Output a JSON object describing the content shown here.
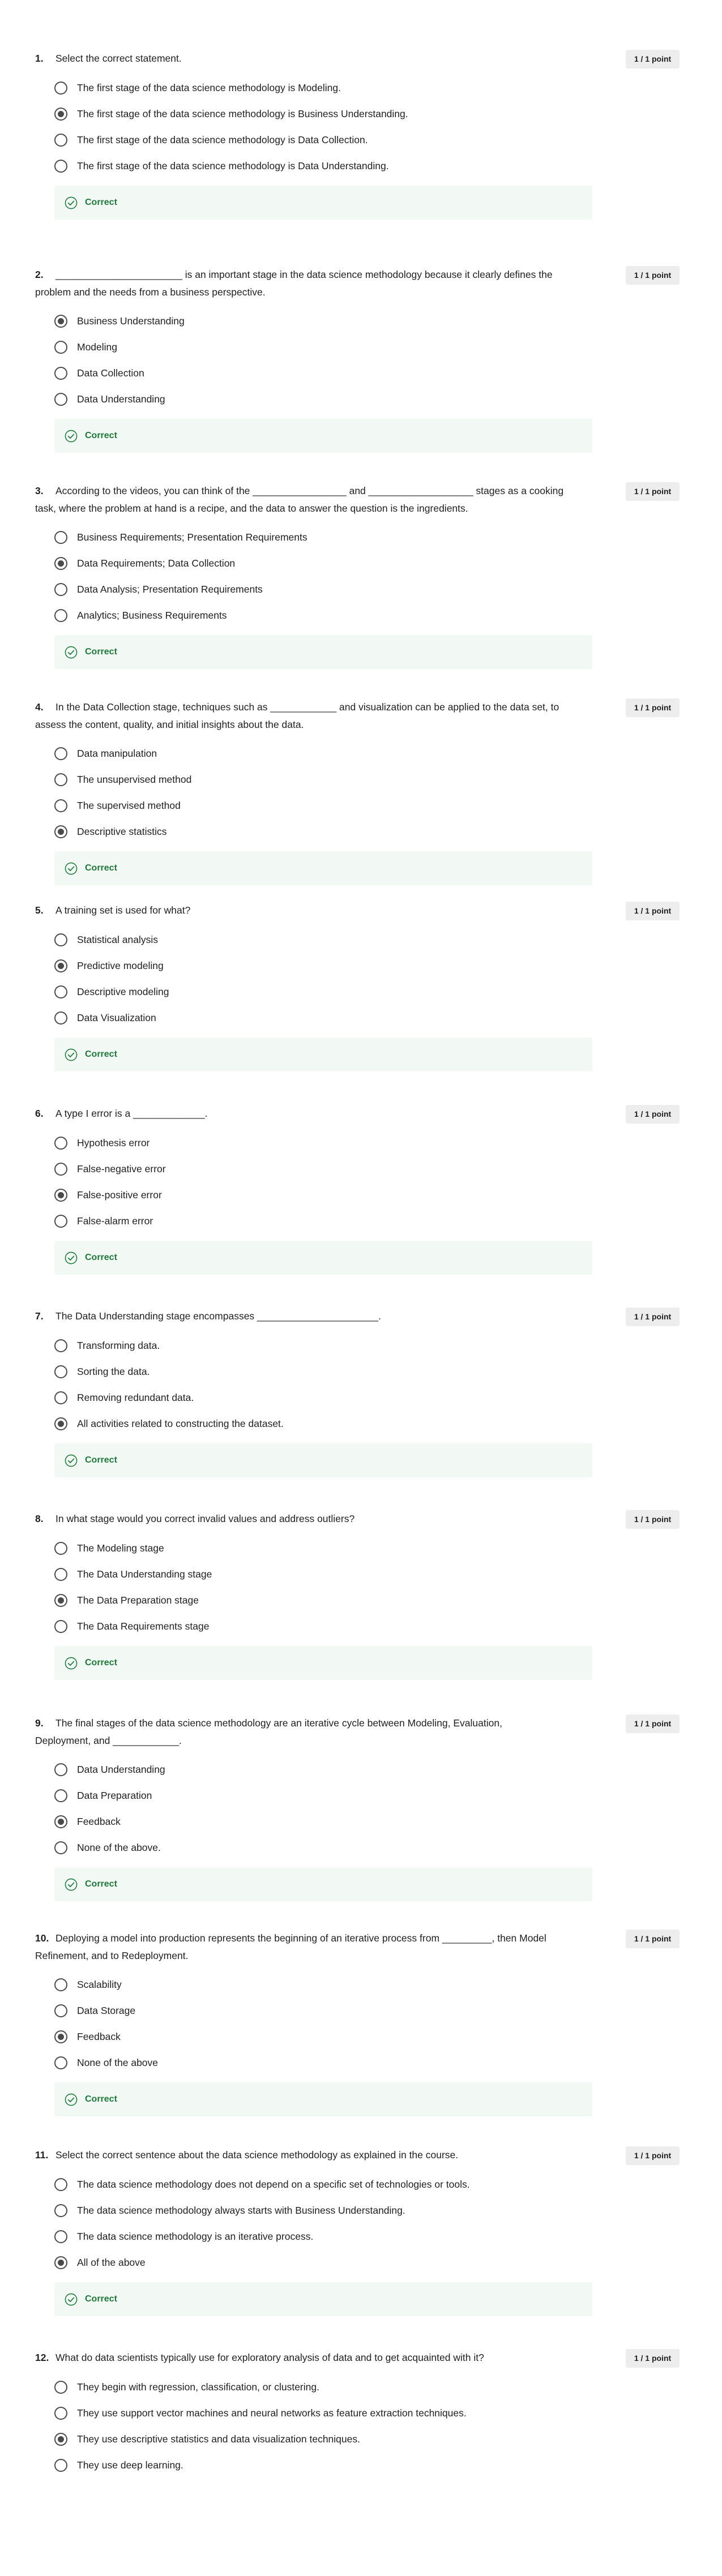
{
  "points_label": "1 / 1 point",
  "correct_label": "Correct",
  "questions": [
    {
      "number": "1.",
      "lines": [
        "Select the correct statement."
      ],
      "options": [
        "The first stage of the data science methodology is Modeling.",
        "The first stage of the data science methodology is Business Understanding.",
        "The first stage of the data science methodology is Data Collection.",
        "The first stage of the data science methodology is Data Understanding."
      ],
      "selected": 1
    },
    {
      "number": "2.",
      "lines": [
        "_______________________ is an important stage in the data science methodology because it clearly defines the",
        "problem and the needs from a business perspective."
      ],
      "options": [
        "Business Understanding",
        "Modeling",
        "Data Collection",
        "Data Understanding"
      ],
      "selected": 0
    },
    {
      "number": "3.",
      "lines": [
        "According to the videos, you can think of the _________________ and ___________________ stages as a cooking",
        "task, where the problem at hand is a recipe, and the data to answer the question is the ingredients."
      ],
      "options": [
        "Business Requirements; Presentation Requirements",
        "Data Requirements; Data Collection",
        "Data Analysis; Presentation Requirements",
        "Analytics; Business Requirements"
      ],
      "selected": 1
    },
    {
      "number": "4.",
      "lines": [
        "In the Data Collection stage, techniques such as ____________ and visualization can be applied to the data set, to",
        "assess the content, quality, and initial insights about the data."
      ],
      "options": [
        "Data manipulation",
        "The unsupervised method",
        "The supervised method",
        "Descriptive statistics"
      ],
      "selected": 3
    },
    {
      "number": "5.",
      "lines": [
        "A training set is used for what?"
      ],
      "options": [
        "Statistical analysis",
        "Predictive modeling",
        "Descriptive modeling",
        "Data Visualization"
      ],
      "selected": 1
    },
    {
      "number": "6.",
      "lines": [
        "A type I error is a _____________."
      ],
      "options": [
        "Hypothesis error",
        "False-negative error",
        "False-positive error",
        "False-alarm error"
      ],
      "selected": 2
    },
    {
      "number": "7.",
      "lines": [
        "The Data Understanding stage encompasses ______________________."
      ],
      "options": [
        "Transforming data.",
        "Sorting the data.",
        "Removing redundant data.",
        "All activities related to constructing the dataset."
      ],
      "selected": 3
    },
    {
      "number": "8.",
      "lines": [
        "In what stage would you correct invalid values and address outliers?"
      ],
      "options": [
        "The Modeling stage",
        "The Data Understanding stage",
        "The Data Preparation stage",
        "The Data Requirements stage"
      ],
      "selected": 2
    },
    {
      "number": "9.",
      "lines": [
        "The final stages of the data science methodology are an iterative cycle between Modeling, Evaluation,",
        "Deployment, and ____________."
      ],
      "options": [
        "Data Understanding",
        "Data Preparation",
        "Feedback",
        "None of the above."
      ],
      "selected": 2
    },
    {
      "number": "10.",
      "lines": [
        "Deploying a model into production represents the beginning of an iterative process from _________, then Model",
        "Refinement, and to Redeployment."
      ],
      "options": [
        "Scalability",
        "Data Storage",
        "Feedback",
        "None of the above"
      ],
      "selected": 2
    },
    {
      "number": "11.",
      "lines": [
        "Select the correct sentence about the data science methodology as explained in the course."
      ],
      "options": [
        "The data science methodology does not depend on a specific set of technologies or tools.",
        "The data science methodology always starts with Business Understanding.",
        "The data science methodology is an iterative process.",
        "All of the above"
      ],
      "selected": 3
    },
    {
      "number": "12.",
      "lines": [
        "What do data scientists typically use for exploratory analysis of data and to get acquainted with it?"
      ],
      "options": [
        "They begin with regression, classification, or clustering.",
        "They use support vector machines and neural networks as feature extraction techniques.",
        "They use descriptive statistics and data visualization techniques.",
        "They use deep learning."
      ],
      "selected": 2
    }
  ]
}
